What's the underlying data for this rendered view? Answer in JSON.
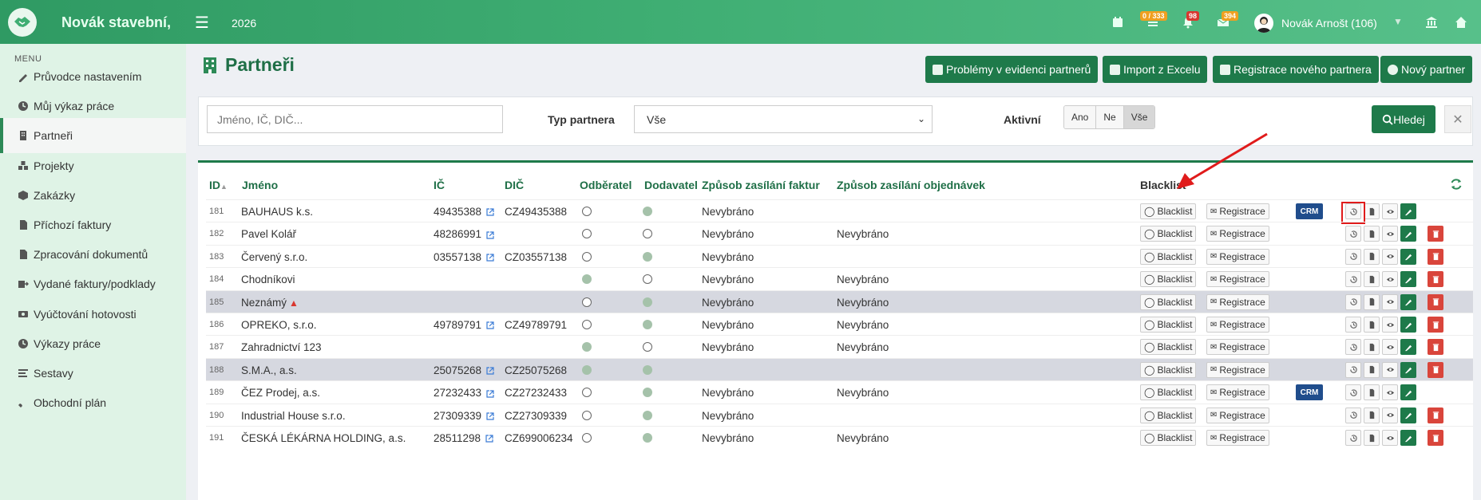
{
  "topbar": {
    "brand": "Novák stavební,",
    "year": "2026",
    "badges": {
      "tasks": "0 / 333",
      "alerts": "98",
      "messages": "394"
    },
    "user": "Novák Arnošt (106)"
  },
  "sidebar": {
    "title": "MENU",
    "items": [
      {
        "label": "Průvodce nastavením",
        "icon": "pencil-icon"
      },
      {
        "label": "Můj výkaz práce",
        "icon": "clock-icon"
      },
      {
        "label": "Partneři",
        "icon": "building-icon",
        "active": true
      },
      {
        "label": "Projekty",
        "icon": "cubes-icon"
      },
      {
        "label": "Zakázky",
        "icon": "cube-icon"
      },
      {
        "label": "Příchozí faktury",
        "icon": "document-icon"
      },
      {
        "label": "Zpracování dokumentů",
        "icon": "document-icon"
      },
      {
        "label": "Vydané faktury/podklady",
        "icon": "export-icon"
      },
      {
        "label": "Vyúčtování hotovosti",
        "icon": "money-icon"
      },
      {
        "label": "Výkazy práce",
        "icon": "clock-icon"
      },
      {
        "label": "Sestavy",
        "icon": "list-icon"
      },
      {
        "label": "Obchodní plán",
        "icon": "rocket-icon"
      }
    ]
  },
  "header": {
    "title": "Partneři",
    "buttons": {
      "problems": "Problémy v evidenci partnerů",
      "import": "Import z Excelu",
      "register": "Registrace nového partnera",
      "new": "Nový partner"
    }
  },
  "filters": {
    "search_placeholder": "Jméno, IČ, DIČ...",
    "type_label": "Typ partnera",
    "type_value": "Vše",
    "active_label": "Aktivní",
    "active_options": [
      "Ano",
      "Ne",
      "Vše"
    ],
    "search_button": "Hledej"
  },
  "table": {
    "headers": {
      "id": "ID",
      "name": "Jméno",
      "ic": "IČ",
      "dic": "DIČ",
      "customer": "Odběratel",
      "supplier": "Dodavatel",
      "invoice_delivery": "Způsob zasílání faktur",
      "order_delivery": "Způsob zasílání objednávek",
      "blacklist": "Blacklist"
    },
    "blacklist_label": "Blacklist",
    "registration_label": "Registrace",
    "crm_label": "CRM",
    "rows": [
      {
        "id": "181",
        "name": "BAUHAUS k.s.",
        "ic": "49435388",
        "dic": "CZ49435388",
        "customer": false,
        "supplier": true,
        "zf": "Nevybráno",
        "zo": "",
        "crm": true,
        "delete": false,
        "hl": false,
        "warn": false
      },
      {
        "id": "182",
        "name": "Pavel Kolář",
        "ic": "48286991",
        "dic": "",
        "customer": false,
        "supplier": false,
        "zf": "Nevybráno",
        "zo": "Nevybráno",
        "crm": false,
        "delete": true,
        "hl": false,
        "warn": false
      },
      {
        "id": "183",
        "name": "Červený s.r.o.",
        "ic": "03557138",
        "dic": "CZ03557138",
        "customer": false,
        "supplier": true,
        "zf": "Nevybráno",
        "zo": "",
        "crm": false,
        "delete": true,
        "hl": false,
        "warn": false
      },
      {
        "id": "184",
        "name": "Chodníkovi",
        "ic": "",
        "dic": "",
        "customer": true,
        "supplier": false,
        "zf": "Nevybráno",
        "zo": "Nevybráno",
        "crm": false,
        "delete": true,
        "hl": false,
        "warn": false
      },
      {
        "id": "185",
        "name": "Neznámý",
        "ic": "",
        "dic": "",
        "customer": false,
        "supplier": true,
        "zf": "Nevybráno",
        "zo": "Nevybráno",
        "crm": false,
        "delete": true,
        "hl": true,
        "warn": true
      },
      {
        "id": "186",
        "name": "OPREKO, s.r.o.",
        "ic": "49789791",
        "dic": "CZ49789791",
        "customer": false,
        "supplier": true,
        "zf": "Nevybráno",
        "zo": "Nevybráno",
        "crm": false,
        "delete": true,
        "hl": false,
        "warn": false
      },
      {
        "id": "187",
        "name": "Zahradnictví 123",
        "ic": "",
        "dic": "",
        "customer": true,
        "supplier": false,
        "zf": "Nevybráno",
        "zo": "Nevybráno",
        "crm": false,
        "delete": true,
        "hl": false,
        "warn": false
      },
      {
        "id": "188",
        "name": "S.M.A., a.s.",
        "ic": "25075268",
        "dic": "CZ25075268",
        "customer": true,
        "supplier": true,
        "zf": "",
        "zo": "",
        "crm": false,
        "delete": true,
        "hl": true,
        "warn": false
      },
      {
        "id": "189",
        "name": "ČEZ Prodej, a.s.",
        "ic": "27232433",
        "dic": "CZ27232433",
        "customer": false,
        "supplier": true,
        "zf": "Nevybráno",
        "zo": "Nevybráno",
        "crm": true,
        "delete": false,
        "hl": false,
        "warn": false
      },
      {
        "id": "190",
        "name": "Industrial House s.r.o.",
        "ic": "27309339",
        "dic": "CZ27309339",
        "customer": false,
        "supplier": true,
        "zf": "Nevybráno",
        "zo": "",
        "crm": false,
        "delete": true,
        "hl": false,
        "warn": false
      },
      {
        "id": "191",
        "name": "ČESKÁ LÉKÁRNA HOLDING, a.s.",
        "ic": "28511298",
        "dic": "CZ699006234",
        "customer": false,
        "supplier": true,
        "zf": "Nevybráno",
        "zo": "Nevybráno",
        "crm": false,
        "delete": true,
        "hl": false,
        "warn": false
      }
    ]
  },
  "colors": {
    "brand_green": "#1e7a4a",
    "header_green": "#3fae73",
    "danger": "#d9453b",
    "crm_blue": "#204d8c",
    "highlight_red": "#e01b1b"
  }
}
